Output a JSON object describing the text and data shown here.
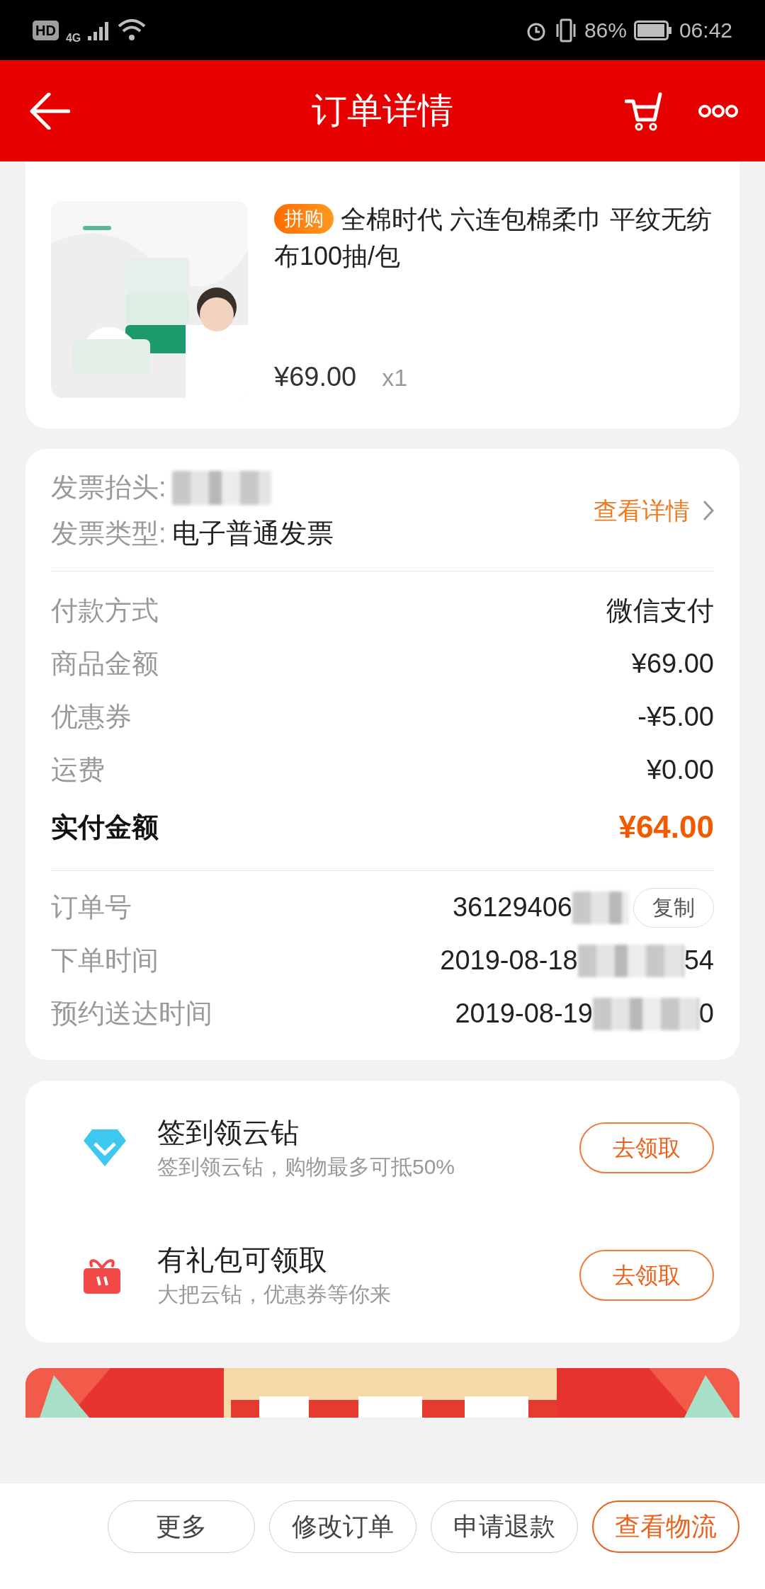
{
  "status_bar": {
    "hd": "HD",
    "network": "4G",
    "battery": "86%",
    "time": "06:42"
  },
  "header": {
    "title": "订单详情"
  },
  "product": {
    "badge": "拼购",
    "name": "全棉时代 六连包棉柔巾 平纹无纺布100抽/包",
    "price": "¥69.00",
    "quantity": "x1"
  },
  "invoice": {
    "title_label": "发票抬头:",
    "type_label": "发票类型:",
    "type_value": "电子普通发票",
    "link": "查看详情"
  },
  "payment": [
    {
      "label": "付款方式",
      "value": "微信支付",
      "kind": "normal"
    },
    {
      "label": "商品金额",
      "value": "¥69.00",
      "kind": "normal"
    },
    {
      "label": "优惠券",
      "value": "-¥5.00",
      "kind": "normal"
    },
    {
      "label": "运费",
      "value": "¥0.00",
      "kind": "normal"
    },
    {
      "label": "实付金额",
      "value": "¥64.00",
      "kind": "total"
    }
  ],
  "order_info": [
    {
      "label": "订单号",
      "value": "36129406",
      "action": "复制"
    },
    {
      "label": "下单时间",
      "value": "2019-08-18",
      "tail": "54"
    },
    {
      "label": "预约送达时间",
      "value": "2019-08-19",
      "tail": "0"
    }
  ],
  "rewards": [
    {
      "kind": "diamond",
      "title": "签到领云钻",
      "subtitle": "签到领云钻，购物最多可抵50%",
      "button": "去领取"
    },
    {
      "kind": "gift",
      "title": "有礼包可领取",
      "subtitle": "大把云钻，优惠券等你来",
      "button": "去领取"
    }
  ],
  "actions": [
    {
      "label": "更多",
      "highlighted": false
    },
    {
      "label": "修改订单",
      "highlighted": false
    },
    {
      "label": "申请退款",
      "highlighted": false
    },
    {
      "label": "查看物流",
      "highlighted": true
    }
  ]
}
